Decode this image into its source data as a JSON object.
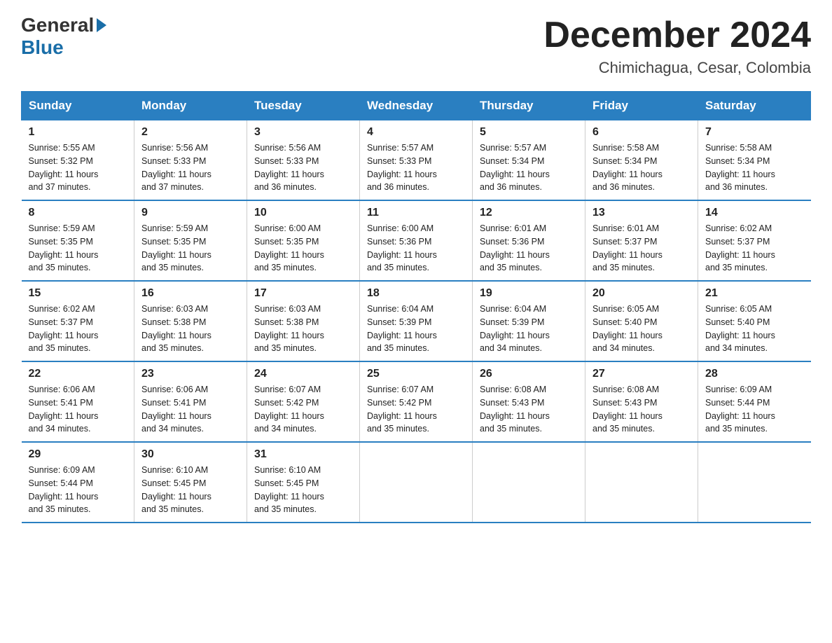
{
  "header": {
    "logo_general": "General",
    "logo_blue": "Blue",
    "month_title": "December 2024",
    "location": "Chimichagua, Cesar, Colombia"
  },
  "days_of_week": [
    "Sunday",
    "Monday",
    "Tuesday",
    "Wednesday",
    "Thursday",
    "Friday",
    "Saturday"
  ],
  "weeks": [
    [
      {
        "day": "1",
        "sunrise": "5:55 AM",
        "sunset": "5:32 PM",
        "daylight": "11 hours and 37 minutes."
      },
      {
        "day": "2",
        "sunrise": "5:56 AM",
        "sunset": "5:33 PM",
        "daylight": "11 hours and 37 minutes."
      },
      {
        "day": "3",
        "sunrise": "5:56 AM",
        "sunset": "5:33 PM",
        "daylight": "11 hours and 36 minutes."
      },
      {
        "day": "4",
        "sunrise": "5:57 AM",
        "sunset": "5:33 PM",
        "daylight": "11 hours and 36 minutes."
      },
      {
        "day": "5",
        "sunrise": "5:57 AM",
        "sunset": "5:34 PM",
        "daylight": "11 hours and 36 minutes."
      },
      {
        "day": "6",
        "sunrise": "5:58 AM",
        "sunset": "5:34 PM",
        "daylight": "11 hours and 36 minutes."
      },
      {
        "day": "7",
        "sunrise": "5:58 AM",
        "sunset": "5:34 PM",
        "daylight": "11 hours and 36 minutes."
      }
    ],
    [
      {
        "day": "8",
        "sunrise": "5:59 AM",
        "sunset": "5:35 PM",
        "daylight": "11 hours and 35 minutes."
      },
      {
        "day": "9",
        "sunrise": "5:59 AM",
        "sunset": "5:35 PM",
        "daylight": "11 hours and 35 minutes."
      },
      {
        "day": "10",
        "sunrise": "6:00 AM",
        "sunset": "5:35 PM",
        "daylight": "11 hours and 35 minutes."
      },
      {
        "day": "11",
        "sunrise": "6:00 AM",
        "sunset": "5:36 PM",
        "daylight": "11 hours and 35 minutes."
      },
      {
        "day": "12",
        "sunrise": "6:01 AM",
        "sunset": "5:36 PM",
        "daylight": "11 hours and 35 minutes."
      },
      {
        "day": "13",
        "sunrise": "6:01 AM",
        "sunset": "5:37 PM",
        "daylight": "11 hours and 35 minutes."
      },
      {
        "day": "14",
        "sunrise": "6:02 AM",
        "sunset": "5:37 PM",
        "daylight": "11 hours and 35 minutes."
      }
    ],
    [
      {
        "day": "15",
        "sunrise": "6:02 AM",
        "sunset": "5:37 PM",
        "daylight": "11 hours and 35 minutes."
      },
      {
        "day": "16",
        "sunrise": "6:03 AM",
        "sunset": "5:38 PM",
        "daylight": "11 hours and 35 minutes."
      },
      {
        "day": "17",
        "sunrise": "6:03 AM",
        "sunset": "5:38 PM",
        "daylight": "11 hours and 35 minutes."
      },
      {
        "day": "18",
        "sunrise": "6:04 AM",
        "sunset": "5:39 PM",
        "daylight": "11 hours and 35 minutes."
      },
      {
        "day": "19",
        "sunrise": "6:04 AM",
        "sunset": "5:39 PM",
        "daylight": "11 hours and 34 minutes."
      },
      {
        "day": "20",
        "sunrise": "6:05 AM",
        "sunset": "5:40 PM",
        "daylight": "11 hours and 34 minutes."
      },
      {
        "day": "21",
        "sunrise": "6:05 AM",
        "sunset": "5:40 PM",
        "daylight": "11 hours and 34 minutes."
      }
    ],
    [
      {
        "day": "22",
        "sunrise": "6:06 AM",
        "sunset": "5:41 PM",
        "daylight": "11 hours and 34 minutes."
      },
      {
        "day": "23",
        "sunrise": "6:06 AM",
        "sunset": "5:41 PM",
        "daylight": "11 hours and 34 minutes."
      },
      {
        "day": "24",
        "sunrise": "6:07 AM",
        "sunset": "5:42 PM",
        "daylight": "11 hours and 34 minutes."
      },
      {
        "day": "25",
        "sunrise": "6:07 AM",
        "sunset": "5:42 PM",
        "daylight": "11 hours and 35 minutes."
      },
      {
        "day": "26",
        "sunrise": "6:08 AM",
        "sunset": "5:43 PM",
        "daylight": "11 hours and 35 minutes."
      },
      {
        "day": "27",
        "sunrise": "6:08 AM",
        "sunset": "5:43 PM",
        "daylight": "11 hours and 35 minutes."
      },
      {
        "day": "28",
        "sunrise": "6:09 AM",
        "sunset": "5:44 PM",
        "daylight": "11 hours and 35 minutes."
      }
    ],
    [
      {
        "day": "29",
        "sunrise": "6:09 AM",
        "sunset": "5:44 PM",
        "daylight": "11 hours and 35 minutes."
      },
      {
        "day": "30",
        "sunrise": "6:10 AM",
        "sunset": "5:45 PM",
        "daylight": "11 hours and 35 minutes."
      },
      {
        "day": "31",
        "sunrise": "6:10 AM",
        "sunset": "5:45 PM",
        "daylight": "11 hours and 35 minutes."
      },
      null,
      null,
      null,
      null
    ]
  ],
  "labels": {
    "sunrise": "Sunrise:",
    "sunset": "Sunset:",
    "daylight": "Daylight:"
  }
}
